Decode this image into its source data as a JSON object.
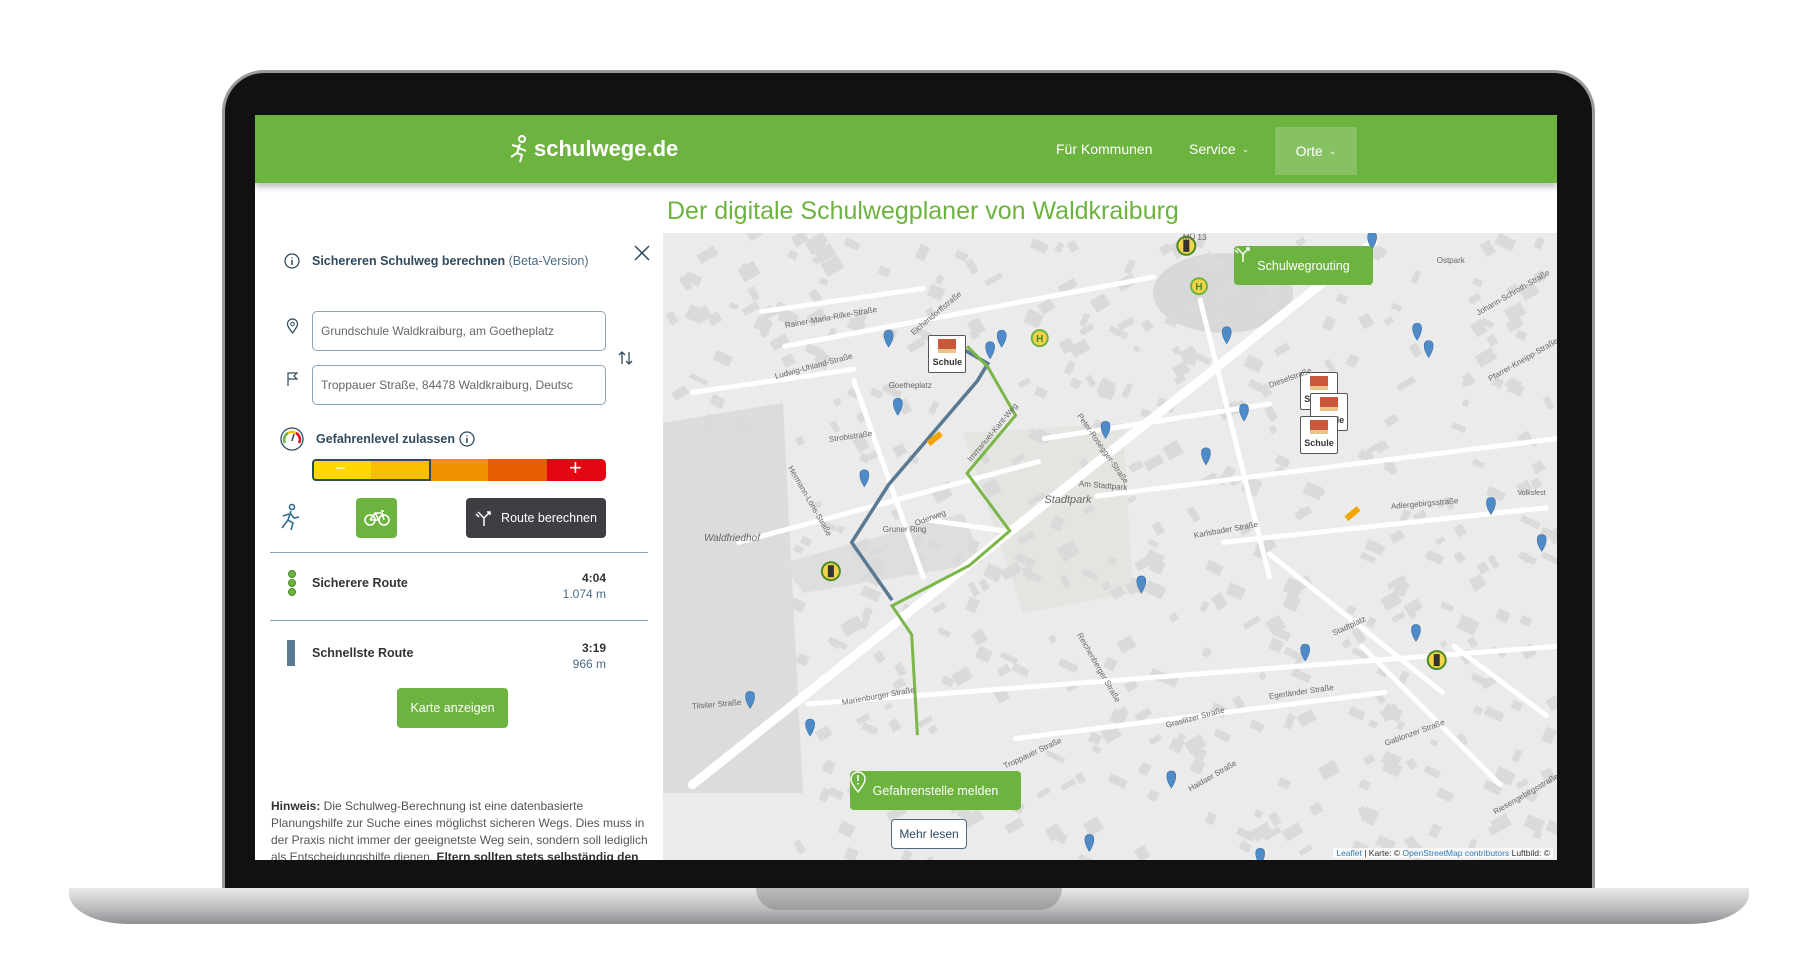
{
  "header": {
    "logo": "schulwege.de",
    "nav": [
      {
        "label": "Für Kommunen"
      },
      {
        "label": "Service"
      },
      {
        "label": "Orte"
      }
    ]
  },
  "page_title": "Der digitale Schulwegplaner von Waldkraiburg",
  "planner": {
    "heading": "Sichereren Schulweg berechnen",
    "heading_suffix": "(Beta-Version)",
    "start_value": "Grundschule Waldkraiburg, am Goetheplatz",
    "destination_value": "Troppauer Straße, 84478 Waldkraiburg, Deutsc",
    "danger_label": "Gefahrenlevel zulassen",
    "danger_level": {
      "selected": 2,
      "max": 5,
      "minus": "−",
      "plus": "+",
      "colors": [
        "#ffd800",
        "#fbbf00",
        "#f39200",
        "#e85d04",
        "#e30613"
      ]
    },
    "modes": [
      {
        "name": "walk",
        "active": false
      },
      {
        "name": "bike",
        "active": true
      }
    ],
    "route_button": "Route berechnen",
    "routes": [
      {
        "name": "Sicherere Route",
        "time": "4:04",
        "distance": "1.074 m",
        "color": "#6db33f"
      },
      {
        "name": "Schnellste Route",
        "time": "3:19",
        "distance": "966 m",
        "color": "#5a7a94"
      }
    ],
    "show_map_button": "Karte anzeigen",
    "hint_label": "Hinweis:",
    "hint_text": " Die Schulweg-Berechnung ist eine datenbasierte Planungshilfe zur Suche eines möglichst sicheren Wegs. Dies muss in der Praxis nicht immer der geeignetste Weg sein, sondern soll lediglich als Entscheidungshilfe dienen. ",
    "hint_bold": "Eltern sollten stets selbständig den für ihr Kind geeignetsten Schulweg wählen."
  },
  "map": {
    "routing_button": "Schulwegrouting",
    "report_button": "Gefahrenstelle melden",
    "more_button": "Mehr lesen",
    "school_label": "Schule",
    "attribution": {
      "leaflet": "Leaflet",
      "karte": " | Karte: © ",
      "osm": "OpenStreetMap contributors",
      "luftbild": " Luftbild: ©"
    },
    "labels": [
      "Stadtpark",
      "Waldfriedhof",
      "Ostpark",
      "Strobistraße",
      "Oderweg",
      "Gruner Ring",
      "Am Stadtpark",
      "Adlergebirgsstraße",
      "Dieselstraße",
      "Karlsbader Straße",
      "Egerländer Straße",
      "Graslitzer Straße",
      "Gablonzer Straße",
      "Reichenberger Straße",
      "Hermann-Löns-Straße",
      "Rainer-Maria-Rilke-Straße",
      "Ludwig-Uhland-Straße",
      "Eichendorffstraße",
      "Goetheplatz",
      "Marienburger Straße",
      "Tilsiter Straße",
      "Stadtplatz",
      "Riesengebirgsstraße",
      "Johann-Schroth-Straße",
      "Pfarrer-Kneipp-Straße",
      "Immanuel-Kant-Weg",
      "Peter-Rosegger-Straße",
      "Troppauer Straße",
      "Haidaer Straße",
      "Volksfest",
      "MÜ 13"
    ],
    "colors": {
      "safe_route": "#7ab648",
      "fast_route": "#5a7a94",
      "pin": "#4f8ac9",
      "hazard": "#f5a500"
    }
  }
}
